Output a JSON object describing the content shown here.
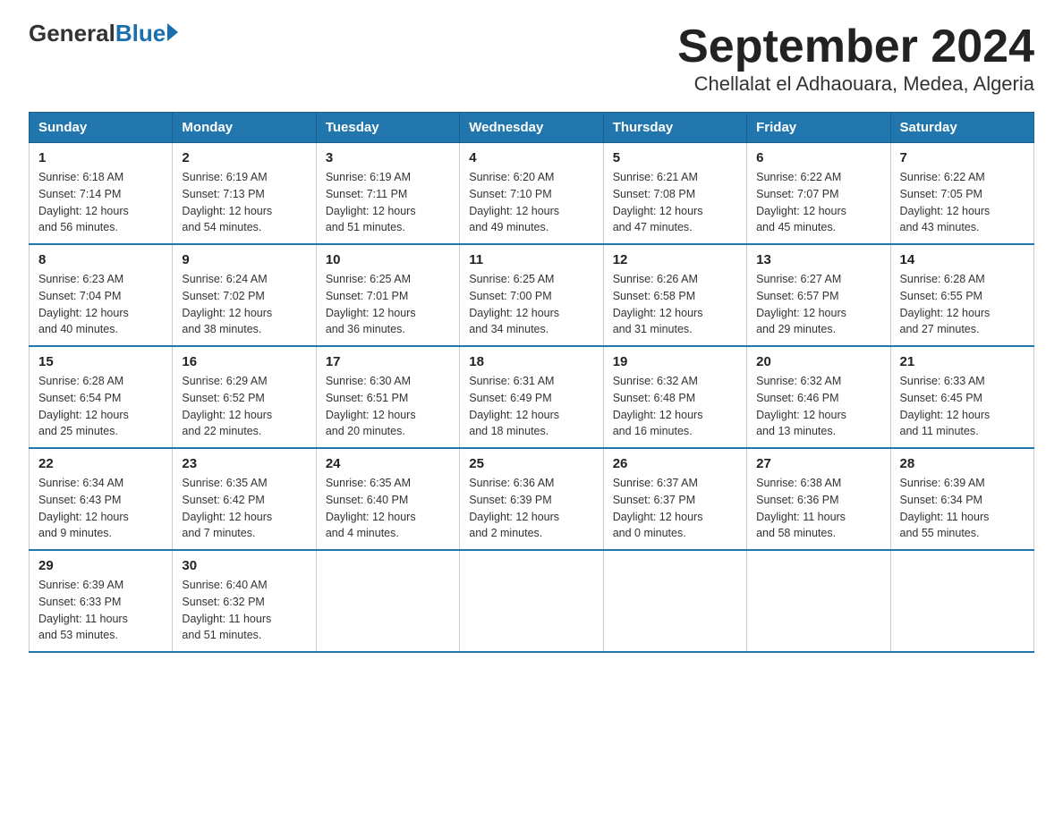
{
  "header": {
    "logo_general": "General",
    "logo_blue": "Blue",
    "title": "September 2024",
    "subtitle": "Chellalat el Adhaouara, Medea, Algeria"
  },
  "weekdays": [
    "Sunday",
    "Monday",
    "Tuesday",
    "Wednesday",
    "Thursday",
    "Friday",
    "Saturday"
  ],
  "weeks": [
    [
      {
        "day": "1",
        "sunrise": "6:18 AM",
        "sunset": "7:14 PM",
        "daylight": "12 hours and 56 minutes."
      },
      {
        "day": "2",
        "sunrise": "6:19 AM",
        "sunset": "7:13 PM",
        "daylight": "12 hours and 54 minutes."
      },
      {
        "day": "3",
        "sunrise": "6:19 AM",
        "sunset": "7:11 PM",
        "daylight": "12 hours and 51 minutes."
      },
      {
        "day": "4",
        "sunrise": "6:20 AM",
        "sunset": "7:10 PM",
        "daylight": "12 hours and 49 minutes."
      },
      {
        "day": "5",
        "sunrise": "6:21 AM",
        "sunset": "7:08 PM",
        "daylight": "12 hours and 47 minutes."
      },
      {
        "day": "6",
        "sunrise": "6:22 AM",
        "sunset": "7:07 PM",
        "daylight": "12 hours and 45 minutes."
      },
      {
        "day": "7",
        "sunrise": "6:22 AM",
        "sunset": "7:05 PM",
        "daylight": "12 hours and 43 minutes."
      }
    ],
    [
      {
        "day": "8",
        "sunrise": "6:23 AM",
        "sunset": "7:04 PM",
        "daylight": "12 hours and 40 minutes."
      },
      {
        "day": "9",
        "sunrise": "6:24 AM",
        "sunset": "7:02 PM",
        "daylight": "12 hours and 38 minutes."
      },
      {
        "day": "10",
        "sunrise": "6:25 AM",
        "sunset": "7:01 PM",
        "daylight": "12 hours and 36 minutes."
      },
      {
        "day": "11",
        "sunrise": "6:25 AM",
        "sunset": "7:00 PM",
        "daylight": "12 hours and 34 minutes."
      },
      {
        "day": "12",
        "sunrise": "6:26 AM",
        "sunset": "6:58 PM",
        "daylight": "12 hours and 31 minutes."
      },
      {
        "day": "13",
        "sunrise": "6:27 AM",
        "sunset": "6:57 PM",
        "daylight": "12 hours and 29 minutes."
      },
      {
        "day": "14",
        "sunrise": "6:28 AM",
        "sunset": "6:55 PM",
        "daylight": "12 hours and 27 minutes."
      }
    ],
    [
      {
        "day": "15",
        "sunrise": "6:28 AM",
        "sunset": "6:54 PM",
        "daylight": "12 hours and 25 minutes."
      },
      {
        "day": "16",
        "sunrise": "6:29 AM",
        "sunset": "6:52 PM",
        "daylight": "12 hours and 22 minutes."
      },
      {
        "day": "17",
        "sunrise": "6:30 AM",
        "sunset": "6:51 PM",
        "daylight": "12 hours and 20 minutes."
      },
      {
        "day": "18",
        "sunrise": "6:31 AM",
        "sunset": "6:49 PM",
        "daylight": "12 hours and 18 minutes."
      },
      {
        "day": "19",
        "sunrise": "6:32 AM",
        "sunset": "6:48 PM",
        "daylight": "12 hours and 16 minutes."
      },
      {
        "day": "20",
        "sunrise": "6:32 AM",
        "sunset": "6:46 PM",
        "daylight": "12 hours and 13 minutes."
      },
      {
        "day": "21",
        "sunrise": "6:33 AM",
        "sunset": "6:45 PM",
        "daylight": "12 hours and 11 minutes."
      }
    ],
    [
      {
        "day": "22",
        "sunrise": "6:34 AM",
        "sunset": "6:43 PM",
        "daylight": "12 hours and 9 minutes."
      },
      {
        "day": "23",
        "sunrise": "6:35 AM",
        "sunset": "6:42 PM",
        "daylight": "12 hours and 7 minutes."
      },
      {
        "day": "24",
        "sunrise": "6:35 AM",
        "sunset": "6:40 PM",
        "daylight": "12 hours and 4 minutes."
      },
      {
        "day": "25",
        "sunrise": "6:36 AM",
        "sunset": "6:39 PM",
        "daylight": "12 hours and 2 minutes."
      },
      {
        "day": "26",
        "sunrise": "6:37 AM",
        "sunset": "6:37 PM",
        "daylight": "12 hours and 0 minutes."
      },
      {
        "day": "27",
        "sunrise": "6:38 AM",
        "sunset": "6:36 PM",
        "daylight": "11 hours and 58 minutes."
      },
      {
        "day": "28",
        "sunrise": "6:39 AM",
        "sunset": "6:34 PM",
        "daylight": "11 hours and 55 minutes."
      }
    ],
    [
      {
        "day": "29",
        "sunrise": "6:39 AM",
        "sunset": "6:33 PM",
        "daylight": "11 hours and 53 minutes."
      },
      {
        "day": "30",
        "sunrise": "6:40 AM",
        "sunset": "6:32 PM",
        "daylight": "11 hours and 51 minutes."
      },
      null,
      null,
      null,
      null,
      null
    ]
  ],
  "labels": {
    "sunrise": "Sunrise:",
    "sunset": "Sunset:",
    "daylight": "Daylight:"
  }
}
